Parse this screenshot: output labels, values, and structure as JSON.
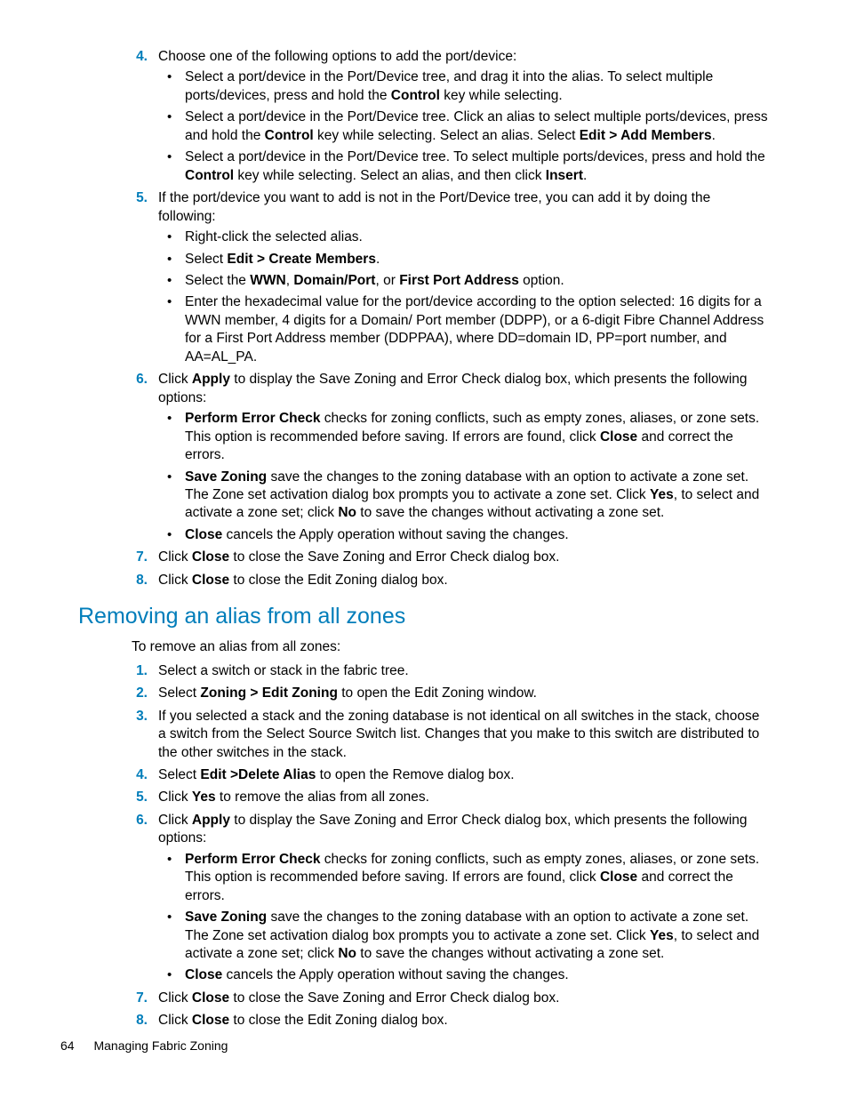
{
  "section1": {
    "items": [
      {
        "num": "4.",
        "text": "Choose one of the following options to add the port/device:",
        "sub": [
          {
            "runs": [
              {
                "t": "Select a port/device in the Port/Device tree, and drag it into the alias. To select multiple ports/devices, press and hold the "
              },
              {
                "t": "Control",
                "b": true
              },
              {
                "t": " key while selecting."
              }
            ]
          },
          {
            "runs": [
              {
                "t": "Select a port/device in the Port/Device tree. Click an alias to select multiple ports/devices, press and hold the "
              },
              {
                "t": "Control",
                "b": true
              },
              {
                "t": " key while selecting. Select an alias. Select "
              },
              {
                "t": "Edit > Add Members",
                "b": true
              },
              {
                "t": "."
              }
            ]
          },
          {
            "runs": [
              {
                "t": "Select a port/device in the Port/Device tree. To select multiple ports/devices, press and hold the "
              },
              {
                "t": "Control",
                "b": true
              },
              {
                "t": " key while selecting. Select an alias, and then click "
              },
              {
                "t": "Insert",
                "b": true
              },
              {
                "t": "."
              }
            ]
          }
        ]
      },
      {
        "num": "5.",
        "text": "If the port/device you want to add is not in the Port/Device tree, you can add it by doing the following:",
        "sub": [
          {
            "runs": [
              {
                "t": "Right-click the selected alias."
              }
            ]
          },
          {
            "runs": [
              {
                "t": "Select "
              },
              {
                "t": "Edit > Create Members",
                "b": true
              },
              {
                "t": "."
              }
            ]
          },
          {
            "runs": [
              {
                "t": "Select the "
              },
              {
                "t": "WWN",
                "b": true
              },
              {
                "t": ", "
              },
              {
                "t": "Domain/Port",
                "b": true
              },
              {
                "t": ", or "
              },
              {
                "t": "First Port Address",
                "b": true
              },
              {
                "t": " option."
              }
            ]
          },
          {
            "runs": [
              {
                "t": "Enter the hexadecimal value for the port/device according to the option selected: 16 digits for a WWN member, 4 digits for a Domain/ Port member (DDPP), or a 6-digit Fibre Channel Address for a First Port Address member (DDPPAA), where DD=domain ID, PP=port number, and AA=AL_PA."
              }
            ]
          }
        ]
      },
      {
        "num": "6.",
        "runs": [
          {
            "t": "Click "
          },
          {
            "t": "Apply",
            "b": true
          },
          {
            "t": " to display the Save Zoning and Error Check dialog box, which presents the following options:"
          }
        ],
        "sub": [
          {
            "runs": [
              {
                "t": "Perform Error Check",
                "b": true
              },
              {
                "t": " checks for zoning conflicts, such as empty zones, aliases, or zone sets. This option is recommended before saving. If errors are found, click "
              },
              {
                "t": "Close",
                "b": true
              },
              {
                "t": " and correct the errors."
              }
            ]
          },
          {
            "runs": [
              {
                "t": "Save Zoning",
                "b": true
              },
              {
                "t": " save the changes to the zoning database with an option to activate a zone set. The Zone set activation dialog box prompts you to activate a zone set. Click "
              },
              {
                "t": "Yes",
                "b": true
              },
              {
                "t": ", to select and activate a zone set; click "
              },
              {
                "t": "No",
                "b": true
              },
              {
                "t": " to save the changes without activating a zone set."
              }
            ]
          },
          {
            "runs": [
              {
                "t": "Close",
                "b": true
              },
              {
                "t": " cancels the Apply operation without saving the changes."
              }
            ]
          }
        ]
      },
      {
        "num": "7.",
        "runs": [
          {
            "t": "Click "
          },
          {
            "t": "Close",
            "b": true
          },
          {
            "t": " to close the Save Zoning and Error Check dialog box."
          }
        ]
      },
      {
        "num": "8.",
        "runs": [
          {
            "t": "Click "
          },
          {
            "t": "Close",
            "b": true
          },
          {
            "t": " to close the Edit Zoning dialog box."
          }
        ]
      }
    ]
  },
  "heading": "Removing an alias from all zones",
  "intro": "To remove an alias from all zones:",
  "section2": {
    "items": [
      {
        "num": "1.",
        "runs": [
          {
            "t": "Select a switch or stack in the fabric tree."
          }
        ]
      },
      {
        "num": "2.",
        "runs": [
          {
            "t": "Select "
          },
          {
            "t": "Zoning > Edit Zoning",
            "b": true
          },
          {
            "t": " to open the Edit Zoning window."
          }
        ]
      },
      {
        "num": "3.",
        "runs": [
          {
            "t": "If you selected a stack and the zoning database is not identical on all switches in the stack, choose a switch from the Select Source Switch list. Changes that you make to this switch are distributed to the other switches in the stack."
          }
        ]
      },
      {
        "num": "4.",
        "runs": [
          {
            "t": "Select "
          },
          {
            "t": "Edit >Delete Alias",
            "b": true
          },
          {
            "t": " to open the Remove dialog box."
          }
        ]
      },
      {
        "num": "5.",
        "runs": [
          {
            "t": "Click "
          },
          {
            "t": "Yes",
            "b": true
          },
          {
            "t": " to remove the alias from all zones."
          }
        ]
      },
      {
        "num": "6.",
        "runs": [
          {
            "t": "Click "
          },
          {
            "t": "Apply",
            "b": true
          },
          {
            "t": " to display the Save Zoning and Error Check dialog box, which presents the following options:"
          }
        ],
        "sub": [
          {
            "runs": [
              {
                "t": "Perform Error Check",
                "b": true
              },
              {
                "t": " checks for zoning conflicts, such as empty zones, aliases, or zone sets. This option is recommended before saving. If errors are found, click "
              },
              {
                "t": "Close",
                "b": true
              },
              {
                "t": " and correct the errors."
              }
            ]
          },
          {
            "runs": [
              {
                "t": "Save Zoning",
                "b": true
              },
              {
                "t": " save the changes to the zoning database with an option to activate a zone set. The Zone set activation dialog box prompts you to activate a zone set. Click "
              },
              {
                "t": "Yes",
                "b": true
              },
              {
                "t": ", to select and activate a zone set; click "
              },
              {
                "t": "No",
                "b": true
              },
              {
                "t": " to save the changes without activating a zone set."
              }
            ]
          },
          {
            "runs": [
              {
                "t": "Close",
                "b": true
              },
              {
                "t": " cancels the Apply operation without saving the changes."
              }
            ]
          }
        ]
      },
      {
        "num": "7.",
        "runs": [
          {
            "t": "Click "
          },
          {
            "t": "Close",
            "b": true
          },
          {
            "t": " to close the Save Zoning and Error Check dialog box."
          }
        ]
      },
      {
        "num": "8.",
        "runs": [
          {
            "t": "Click "
          },
          {
            "t": "Close",
            "b": true
          },
          {
            "t": " to close the Edit Zoning dialog box."
          }
        ]
      }
    ]
  },
  "footer": {
    "page": "64",
    "title": "Managing Fabric Zoning"
  }
}
